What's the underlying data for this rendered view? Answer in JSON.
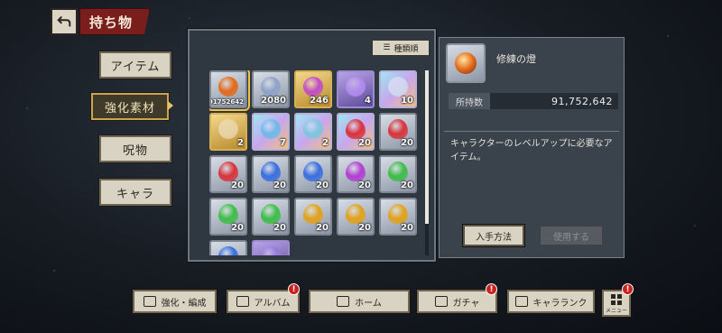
{
  "header": {
    "title": "持ち物"
  },
  "side_tabs": [
    {
      "label": "アイテム",
      "active": false
    },
    {
      "label": "強化素材",
      "active": true
    },
    {
      "label": "呪物",
      "active": false
    },
    {
      "label": "キャラ",
      "active": false
    }
  ],
  "sort": {
    "label": "種類順",
    "icon": "sort-icon"
  },
  "items": [
    {
      "count": "91752642",
      "color": "#e36b1c",
      "frame": "gray",
      "icon": "ember-orb-icon"
    },
    {
      "count": "2080",
      "color": "#8fa2c8",
      "frame": "gray",
      "icon": "crystal-icon"
    },
    {
      "count": "246",
      "color": "#c14fc2",
      "frame": "gold",
      "icon": "crystal-icon"
    },
    {
      "count": "4",
      "color": "#b38af0",
      "frame": "purple",
      "icon": "crystal-wings-icon"
    },
    {
      "count": "10",
      "color": "#cfd8ef",
      "frame": "rainbow",
      "icon": "shard-icon"
    },
    {
      "count": "2",
      "color": "#e8d3a6",
      "frame": "gold",
      "icon": "feather-icon"
    },
    {
      "count": "7",
      "color": "#6fb9e8",
      "frame": "rainbow",
      "icon": "spirit-icon"
    },
    {
      "count": "2",
      "color": "#7ec6e0",
      "frame": "rainbow",
      "icon": "statue-icon"
    },
    {
      "count": "20",
      "color": "#d8343c",
      "frame": "rainbow",
      "icon": "flame-icon"
    },
    {
      "count": "20",
      "color": "#d8343c",
      "frame": "gray",
      "icon": "flame-icon"
    },
    {
      "count": "20",
      "color": "#d8343c",
      "frame": "gray",
      "icon": "flame-icon"
    },
    {
      "count": "20",
      "color": "#3a6fe0",
      "frame": "gray",
      "icon": "flame-icon"
    },
    {
      "count": "20",
      "color": "#3a6fe0",
      "frame": "gray",
      "icon": "flame-icon"
    },
    {
      "count": "20",
      "color": "#b23fd2",
      "frame": "gray",
      "icon": "flame-icon"
    },
    {
      "count": "20",
      "color": "#3fbd4a",
      "frame": "gray",
      "icon": "flame-icon"
    },
    {
      "count": "20",
      "color": "#3fbd4a",
      "frame": "gray",
      "icon": "flame-icon"
    },
    {
      "count": "20",
      "color": "#3fbd4a",
      "frame": "gray",
      "icon": "flame-icon"
    },
    {
      "count": "20",
      "color": "#e0a21e",
      "frame": "gray",
      "icon": "flame-icon"
    },
    {
      "count": "20",
      "color": "#e0a21e",
      "frame": "gray",
      "icon": "flame-icon"
    },
    {
      "count": "20",
      "color": "#e0a21e",
      "frame": "gray",
      "icon": "flame-icon"
    },
    {
      "count": "",
      "color": "#3a6fe0",
      "frame": "gray",
      "icon": "orb-icon"
    },
    {
      "count": "",
      "color": "#9a7ae0",
      "frame": "purple",
      "icon": "orb-icon"
    }
  ],
  "detail": {
    "name": "修練の燈",
    "icon": "ember-orb-icon",
    "icon_color": "#e36b1c",
    "qty_label": "所持数",
    "qty_value": "91,752,642",
    "description": "キャラクターのレベルアップに必要なアイテム。",
    "acquire_label": "入手方法",
    "use_label": "使用する"
  },
  "bottom_nav": [
    {
      "label": "強化・編成",
      "icon": "team-icon",
      "badge": ""
    },
    {
      "label": "アルバム",
      "icon": "album-icon",
      "badge": "!"
    },
    {
      "label": "ホーム",
      "icon": "home-icon",
      "badge": ""
    },
    {
      "label": "ガチャ",
      "icon": "gacha-icon",
      "badge": "!"
    },
    {
      "label": "キャラランク",
      "icon": "rank-icon",
      "badge": ""
    }
  ],
  "menu": {
    "label": "メニュー",
    "badge": "!"
  }
}
